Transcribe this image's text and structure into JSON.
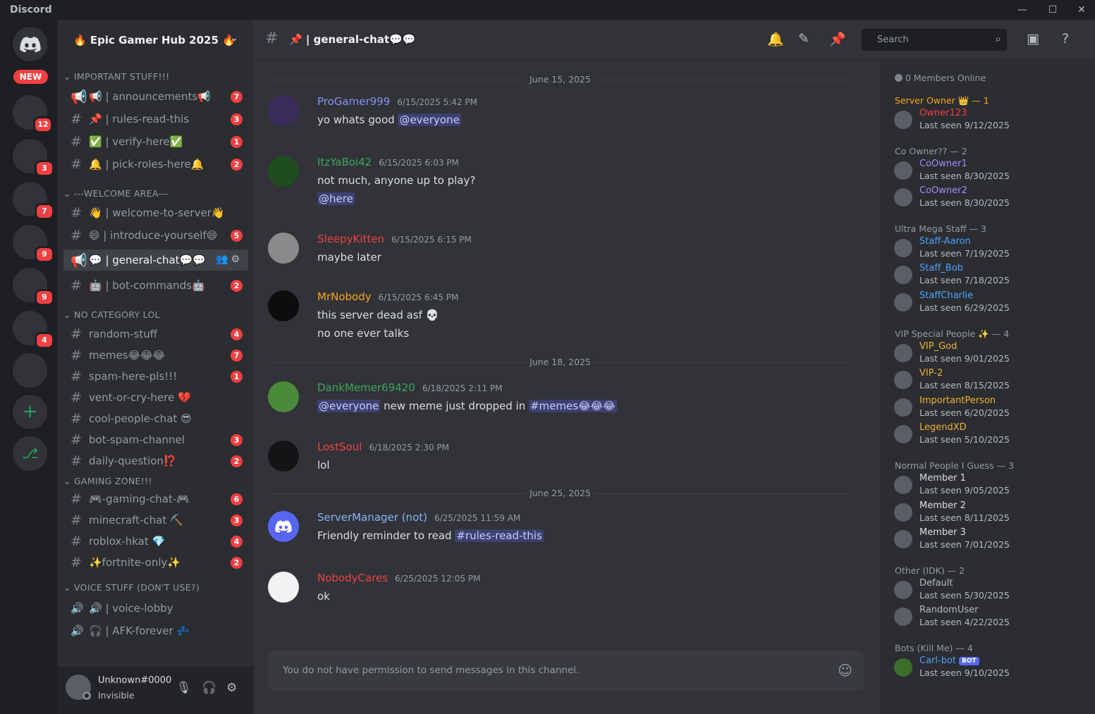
{
  "titlebar": {
    "app_name": "Discord",
    "minimize": "—",
    "maximize": "☐",
    "close": "✕"
  },
  "rail": {
    "new_label": "NEW",
    "servers": [
      {
        "badge": "12"
      },
      {
        "badge": "3"
      },
      {
        "badge": "7"
      },
      {
        "badge": "9"
      },
      {
        "badge": "9"
      },
      {
        "badge": "4"
      },
      {
        "badge": ""
      }
    ],
    "add_icon": "+",
    "discover_icon": "⎇"
  },
  "server": {
    "name": "🔥 Epic Gamer Hub 2025 🔥",
    "chevron": "⌄"
  },
  "categories": {
    "important": "⌄ IMPORTANT STUFF!!!",
    "welcome": "⌄ ---WELCOME AREA---",
    "nocat": "⌄ NO CATEGORY LOL",
    "gaming": "⌄ GAMING ZONE!!!",
    "voice": "⌄ VOICE STUFF (DON'T USE?)"
  },
  "channels": [
    {
      "icon": "📢",
      "name": "📢 | announcements📢",
      "count": "7"
    },
    {
      "icon": "#",
      "name": "📌 | rules-read-this",
      "count": "3"
    },
    {
      "icon": "#",
      "name": "✅ | verify-here✅",
      "count": "1"
    },
    {
      "icon": "#",
      "name": "🔔 | pick-roles-here🔔",
      "count": "2"
    },
    {
      "icon": "#",
      "name": "👋 | welcome-to-server👋",
      "count": ""
    },
    {
      "icon": "#",
      "name": "😄 | introduce-yourself😄",
      "count": "5"
    },
    {
      "icon": "📢",
      "name": "💬 | general-chat💬💬",
      "count": ""
    },
    {
      "icon": "#",
      "name": "🤖 | bot-commands🤖",
      "count": "2"
    },
    {
      "icon": "#",
      "name": "random-stuff",
      "count": "4"
    },
    {
      "icon": "#",
      "name": "memes😂😂😂",
      "count": "7"
    },
    {
      "icon": "#",
      "name": "spam-here-pls!!!",
      "count": "1"
    },
    {
      "icon": "#",
      "name": "vent-or-cry-here 💔",
      "count": ""
    },
    {
      "icon": "#",
      "name": "cool-people-chat 😎",
      "count": ""
    },
    {
      "icon": "#",
      "name": "bot-spam-channel",
      "count": "3"
    },
    {
      "icon": "#",
      "name": "daily-question⁉️",
      "count": "2"
    },
    {
      "icon": "#",
      "name": "🎮-gaming-chat-🎮",
      "count": "6"
    },
    {
      "icon": "#",
      "name": "minecraft-chat ⛏️",
      "count": "3"
    },
    {
      "icon": "#",
      "name": "roblox-hkat 💎",
      "count": "4"
    },
    {
      "icon": "#",
      "name": "✨fortnite-only✨",
      "count": "2"
    },
    {
      "icon": "🔊",
      "name": "🔊 | voice-lobby",
      "count": ""
    },
    {
      "icon": "🔊",
      "name": "🎧 | AFK-forever 💤",
      "count": ""
    }
  ],
  "user": {
    "name": "Unknown#0000",
    "status": "Invisible",
    "mute": "🎙",
    "deafen": "🎧",
    "settings": "⚙"
  },
  "chat": {
    "channel_title": "📌 | general-chat💬💬",
    "search_placeholder": "Search",
    "composer_placeholder": "You do not have permission to send messages in this channel.",
    "dates": [
      "June 15, 2025",
      "June 18, 2025",
      "June 25, 2025"
    ],
    "messages": [
      {
        "author": "ProGamer999",
        "color": "#5865f2",
        "time": "6/15/2025 5:42 PM",
        "lines": [
          "yo whats good",
          "@everyone"
        ]
      },
      {
        "author": "ItzYaBoi42",
        "color": "#3ba55c",
        "time": "6/15/2025 6:03 PM",
        "lines": [
          "not much, anyone up to play?",
          "@here"
        ]
      },
      {
        "author": "SleepyKitten",
        "color": "#ed4245",
        "time": "6/15/2025 6:15 PM",
        "lines": [
          "maybe later"
        ]
      },
      {
        "author": "MrNobody",
        "color": "#faa61a",
        "time": "6/15/2025 6:45 PM",
        "lines": [
          "this server dead asf 💀",
          "no one ever talks"
        ]
      },
      {
        "author": "DankMemer69420",
        "color": "#3ba55c",
        "time": "6/18/2025 2:11 PM",
        "lines": [
          "@everyone",
          " new meme just dropped in ",
          "#memes😂😂😂"
        ]
      },
      {
        "author": "LostSoul",
        "color": "#ed4245",
        "time": "6/18/2025 2:30 PM",
        "lines": [
          "lol"
        ]
      },
      {
        "author": "ServerManager (not)",
        "color": "#5865f2",
        "time": "6/25/2025 11:59 AM",
        "lines": [
          "Friendly reminder to read ",
          "#rules-read-this"
        ]
      },
      {
        "author": "NobodyCares",
        "color": "#ed4245",
        "time": "6/25/2025 12:05 PM",
        "lines": [
          "ok"
        ]
      }
    ]
  },
  "members": {
    "online": "0 Members Online",
    "groups": [
      {
        "title": "Server Owner 👑 — 1",
        "color": "#faa61a",
        "members": [
          {
            "name": "Owner123",
            "color": "#f23f43",
            "seen": "Last seen 9/12/2025"
          }
        ]
      },
      {
        "title": "Co Owner?? — 2",
        "color": "#949ba4",
        "members": [
          {
            "name": "CoOwner1",
            "color": "#a78bfa",
            "seen": "Last seen 8/30/2025"
          },
          {
            "name": "CoOwner2",
            "color": "#a78bfa",
            "seen": "Last seen 8/30/2025"
          }
        ]
      },
      {
        "title": "Ultra Mega Staff — 3",
        "color": "#949ba4",
        "members": [
          {
            "name": "Staff-Aaron",
            "color": "#4ea2ff",
            "seen": "Last seen 7/19/2025"
          },
          {
            "name": "Staff_Bob",
            "color": "#4ea2ff",
            "seen": "Last seen 7/18/2025"
          },
          {
            "name": "StaffCharlie",
            "color": "#4ea2ff",
            "seen": "Last seen 6/29/2025"
          }
        ]
      },
      {
        "title": "VIP Special People ✨ — 4",
        "color": "#949ba4",
        "members": [
          {
            "name": "VIP_God",
            "color": "#f0b232",
            "seen": "Last seen 9/01/2025"
          },
          {
            "name": "VIP-2",
            "color": "#f0b232",
            "seen": "Last seen 8/15/2025"
          },
          {
            "name": "ImportantPerson",
            "color": "#f0b232",
            "seen": "Last seen 6/20/2025"
          },
          {
            "name": "LegendXD",
            "color": "#f0b232",
            "seen": "Last seen 5/10/2025"
          }
        ]
      },
      {
        "title": "Normal People I Guess — 3",
        "color": "#949ba4",
        "members": [
          {
            "name": "Member 1",
            "color": "#dbdee1",
            "seen": "Last seen 9/05/2025"
          },
          {
            "name": "Member 2",
            "color": "#dbdee1",
            "seen": "Last seen 8/11/2025"
          },
          {
            "name": "Member 3",
            "color": "#dbdee1",
            "seen": "Last seen 7/01/2025"
          }
        ]
      },
      {
        "title": "Other (IDK) — 2",
        "color": "#949ba4",
        "members": [
          {
            "name": "Default",
            "color": "#b5bac1",
            "seen": "Last seen 5/30/2025"
          },
          {
            "name": "RandomUser",
            "color": "#b5bac1",
            "seen": "Last seen 4/22/2025"
          }
        ]
      },
      {
        "title": "Bots (Kill Me) — 4",
        "color": "#949ba4",
        "members": [
          {
            "name": "Carl-bot",
            "color": "#4ea2ff",
            "seen": "Last seen 9/10/2025",
            "bot": "BOT"
          }
        ]
      }
    ]
  }
}
